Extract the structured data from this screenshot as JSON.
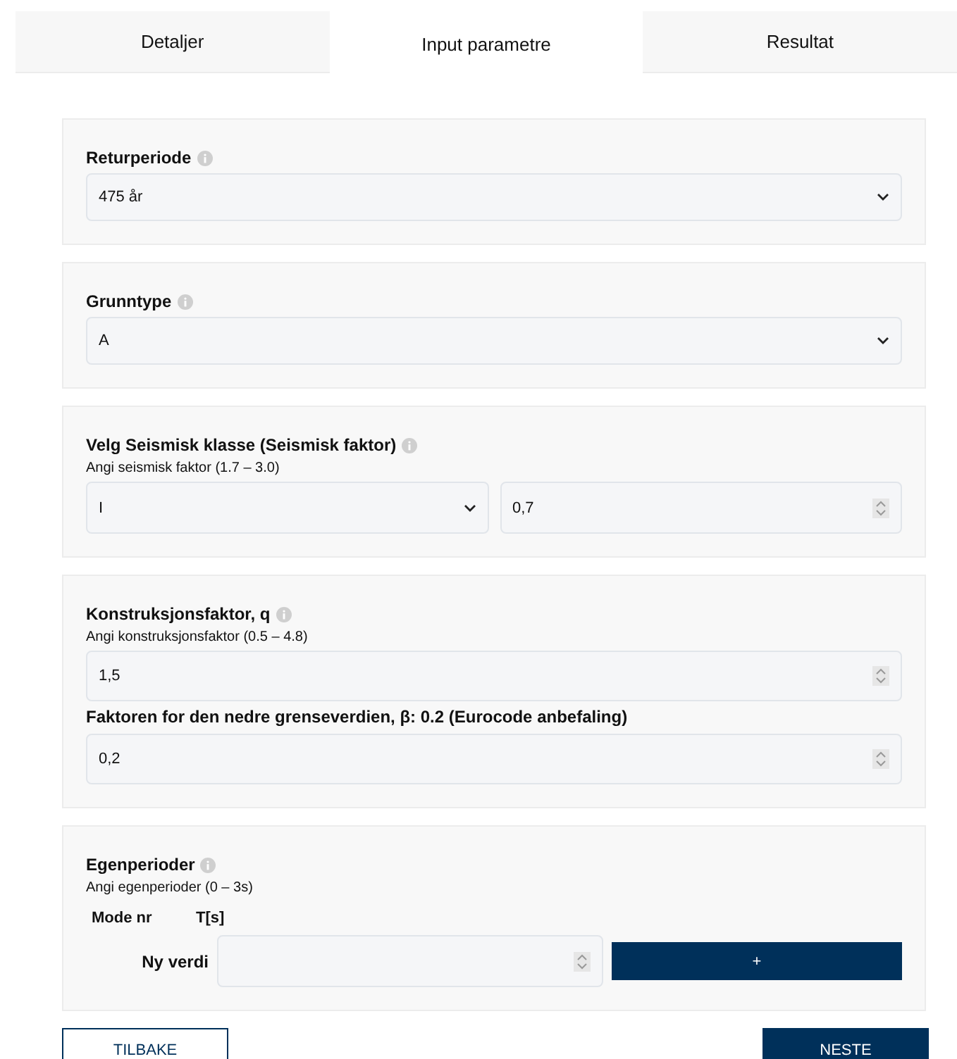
{
  "tabs": [
    {
      "label": "Detaljer",
      "selected": false
    },
    {
      "label": "Input parametre",
      "selected": true
    },
    {
      "label": "Resultat",
      "selected": false
    }
  ],
  "sections": [
    {
      "title": "Returperiode",
      "items": [
        {
          "kind": "select",
          "value": "475 år"
        }
      ]
    },
    {
      "title": "Grunntype",
      "items": [
        {
          "kind": "select",
          "value": "A"
        }
      ]
    },
    {
      "title": "Velg Seismisk klasse (Seismisk faktor)",
      "hint": "Angi seismisk faktor (1.7 – 3.0)",
      "items": [
        {
          "kind": "pair",
          "fields": [
            {
              "kind": "select",
              "value": "I"
            },
            {
              "kind": "number",
              "value": "0,7"
            }
          ]
        }
      ]
    },
    {
      "title": "Konstruksjonsfaktor, q",
      "hint": "Angi konstruksjonsfaktor (0.5 – 4.8)",
      "items": [
        {
          "kind": "number",
          "value": "1,5"
        },
        {
          "kind": "label",
          "text": "Faktoren for den nedre grenseverdien, β: 0.2 (Eurocode anbefaling)"
        },
        {
          "kind": "number",
          "value": "0,2"
        }
      ]
    },
    {
      "title": "Egenperioder",
      "hint": "Angi egenperioder (0 – 3s)",
      "items": [
        {
          "kind": "columns",
          "columns": [
            "Mode nr",
            "T[s]"
          ]
        },
        {
          "kind": "new_value",
          "label": "Ny verdi",
          "button": "+"
        }
      ]
    }
  ],
  "nav": {
    "back": "TILBAKE",
    "next": "NESTE"
  }
}
